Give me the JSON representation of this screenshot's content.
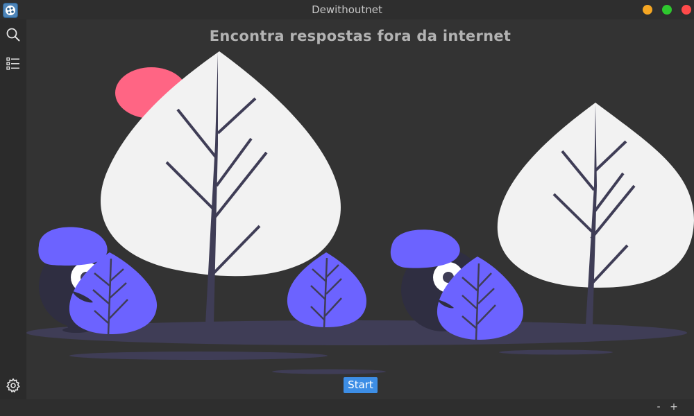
{
  "window": {
    "title": "Dewithoutnet",
    "app_icon": "app-logo-icon",
    "controls": [
      "minimize",
      "maximize",
      "close"
    ],
    "colors": {
      "minimize": "#f5a623",
      "maximize": "#2ec82e",
      "close": "#ff4a4a"
    }
  },
  "sidebar": {
    "top_items": [
      {
        "icon": "search-icon"
      },
      {
        "icon": "list-icon"
      }
    ],
    "bottom_items": [
      {
        "icon": "gear-icon"
      }
    ]
  },
  "main": {
    "headline": "Encontra respostas fora da internet",
    "start_label": "Start",
    "accent_color": "#3d8ee6"
  },
  "statusbar": {
    "zoom_out_label": "-",
    "zoom_in_label": "+"
  }
}
